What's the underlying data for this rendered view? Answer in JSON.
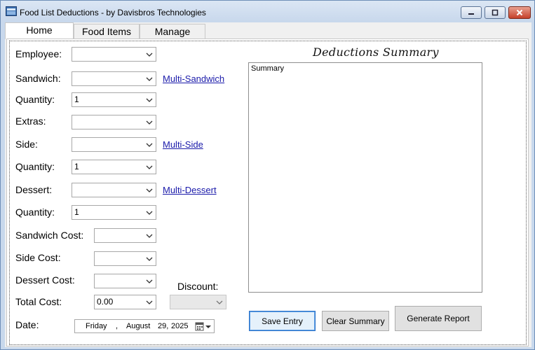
{
  "window": {
    "title": "Food List Deductions - by Davisbros Technologies"
  },
  "tabs": [
    {
      "label": "Home",
      "active": true
    },
    {
      "label": "Food Items",
      "active": false
    },
    {
      "label": "Manage",
      "active": false
    }
  ],
  "form": {
    "employee_label": "Employee:",
    "employee_value": "",
    "sandwich_label": "Sandwich:",
    "sandwich_value": "",
    "multi_sandwich_link": "Multi-Sandwich",
    "sandwich_qty_label": "Quantity:",
    "sandwich_qty_value": "1",
    "extras_label": "Extras:",
    "extras_value": "",
    "side_label": "Side:",
    "side_value": "",
    "multi_side_link": "Multi-Side",
    "side_qty_label": "Quantity:",
    "side_qty_value": "1",
    "dessert_label": "Dessert:",
    "dessert_value": "",
    "multi_dessert_link": "Multi-Dessert",
    "dessert_qty_label": "Quantity:",
    "dessert_qty_value": "1",
    "sandwich_cost_label": "Sandwich Cost:",
    "sandwich_cost_value": "",
    "side_cost_label": "Side Cost:",
    "side_cost_value": "",
    "dessert_cost_label": "Dessert Cost:",
    "dessert_cost_value": "",
    "discount_label": "Discount:",
    "discount_value": "",
    "total_cost_label": "Total Cost:",
    "total_cost_value": "0.00",
    "date_label": "Date:",
    "date_weekday": "Friday",
    "date_comma1": ",",
    "date_month": "August",
    "date_day": "29,",
    "date_year": "2025"
  },
  "summary": {
    "title": "Deductions Summary",
    "text": "Summary"
  },
  "buttons": {
    "save_entry": "Save Entry",
    "clear_summary": "Clear Summary",
    "generate_report": "Generate Report"
  },
  "colors": {
    "link": "#1a1aaa",
    "close_button": "#c5402a",
    "focus_border": "#2b72c9"
  },
  "icons": [
    "app-icon",
    "minimize-icon",
    "maximize-icon",
    "close-icon",
    "chevron-down-icon",
    "calendar-icon"
  ]
}
